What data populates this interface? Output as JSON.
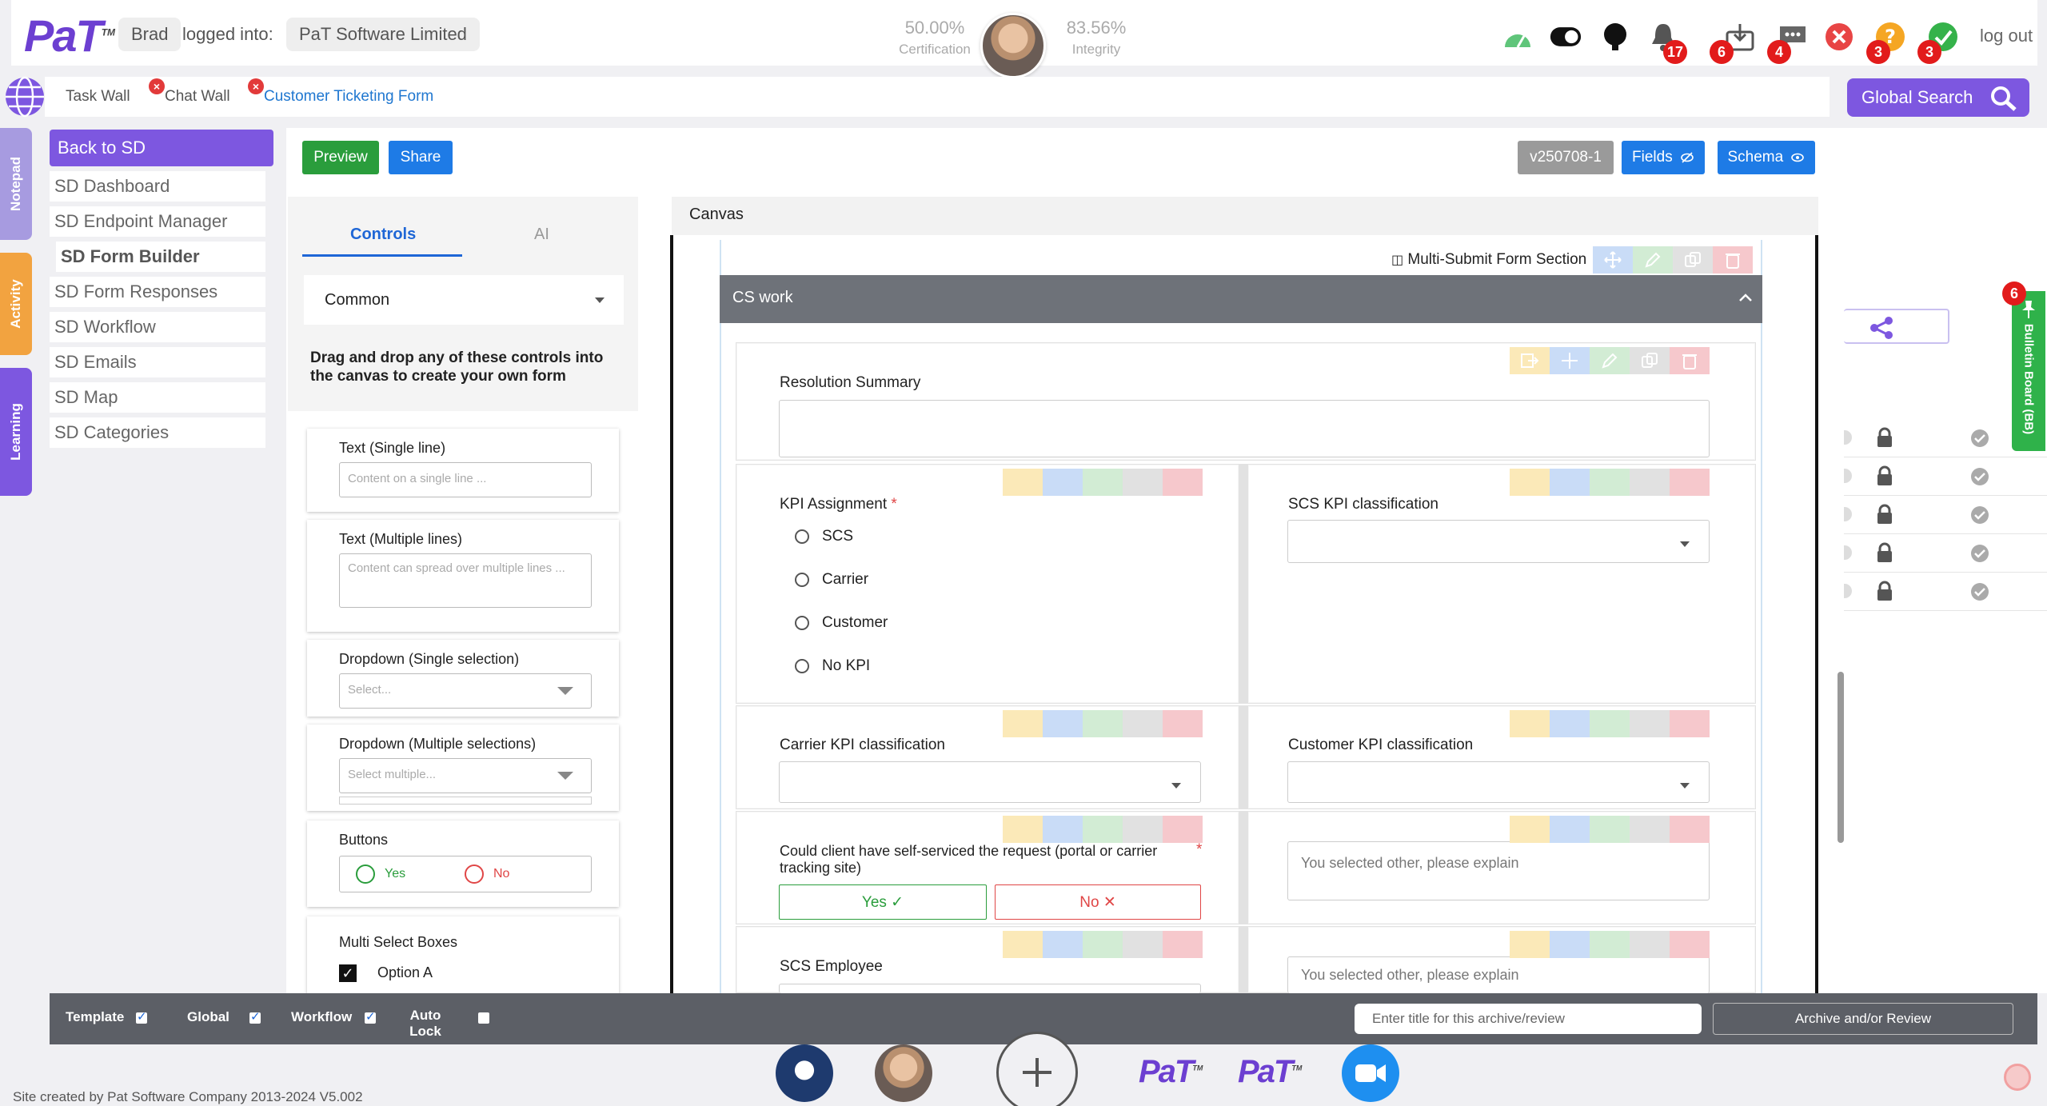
{
  "header": {
    "logo_text": "PaT",
    "logo_tm": "TM",
    "user": "Brad",
    "logged_into_label": "logged into:",
    "company": "PaT Software Limited",
    "certification_value": "50.00%",
    "certification_label": "Certification",
    "integrity_value": "83.56%",
    "integrity_label": "Integrity",
    "notifications_count": "17",
    "inbox_count": "6",
    "messages_count": "4",
    "help_count": "3",
    "approvals_count": "3",
    "logout": "log out"
  },
  "tabs": [
    {
      "label": "Task Wall"
    },
    {
      "label": "Chat Wall"
    },
    {
      "label": "Customer Ticketing Form"
    }
  ],
  "global_search": {
    "label": "Global Search"
  },
  "side_tabs": {
    "notepad": "Notepad",
    "activity": "Activity",
    "learning": "Learning"
  },
  "sd_menu": {
    "back": "Back to SD",
    "items": [
      {
        "label": "SD Dashboard"
      },
      {
        "label": "SD Endpoint Manager"
      },
      {
        "label": "SD Form Builder"
      },
      {
        "label": "SD Form Responses"
      },
      {
        "label": "SD Workflow"
      },
      {
        "label": "SD Emails"
      },
      {
        "label": "SD Map"
      },
      {
        "label": "SD Categories"
      }
    ]
  },
  "toolbar": {
    "preview": "Preview",
    "share": "Share",
    "version": "v250708-1",
    "fields": "Fields",
    "schema": "Schema"
  },
  "controls": {
    "tab_controls": "Controls",
    "tab_ai": "AI",
    "category": "Common",
    "help_text": "Drag and drop any of these controls into the canvas to create your own form",
    "items": [
      {
        "title": "Text (Single line)",
        "placeholder": "Content on a single line ..."
      },
      {
        "title": "Text (Multiple lines)",
        "placeholder": "Content can spread over multiple lines ..."
      },
      {
        "title": "Dropdown (Single selection)",
        "placeholder": "Select..."
      },
      {
        "title": "Dropdown (Multiple selections)",
        "placeholder": "Select multiple..."
      },
      {
        "title": "Buttons",
        "yes": "Yes",
        "no": "No"
      },
      {
        "title": "Multi Select Boxes",
        "option": "Option A"
      }
    ]
  },
  "canvas": {
    "title": "Canvas",
    "section_label": "Multi-Submit Form Section",
    "section_title": "CS work",
    "fields": {
      "resolution_summary": "Resolution Summary",
      "kpi_assignment": "KPI Assignment",
      "kpi_options": [
        "SCS",
        "Carrier",
        "Customer",
        "No KPI"
      ],
      "scs_kpi": "SCS KPI classification",
      "carrier_kpi": "Carrier KPI classification",
      "customer_kpi": "Customer KPI classification",
      "self_service_question": "Could client have self-serviced the request (portal or carrier tracking site)",
      "yes": "Yes",
      "no": "No",
      "other_explain_1": "You selected other, please explain",
      "scs_employee": "SCS Employee",
      "other_explain_2": "You selected other, please explain"
    }
  },
  "right_panel": {
    "bulletin_count": "6",
    "bulletin_label": "Bulletin Board (BB)"
  },
  "bottom_bar": {
    "template": "Template",
    "global": "Global",
    "workflow": "Workflow",
    "auto_lock": "Auto Lock",
    "archive_placeholder": "Enter title for this archive/review",
    "archive_button": "Archive and/or Review"
  },
  "footer": {
    "credit": "Site created by Pat Software Company 2013-2024 V5.002"
  },
  "colors": {
    "brand_purple": "#7d57e0",
    "preview_green": "#2a9d3c",
    "share_blue": "#1e7be6",
    "bulletin_green": "#2fb24a",
    "badge_red": "#e21b1b"
  }
}
